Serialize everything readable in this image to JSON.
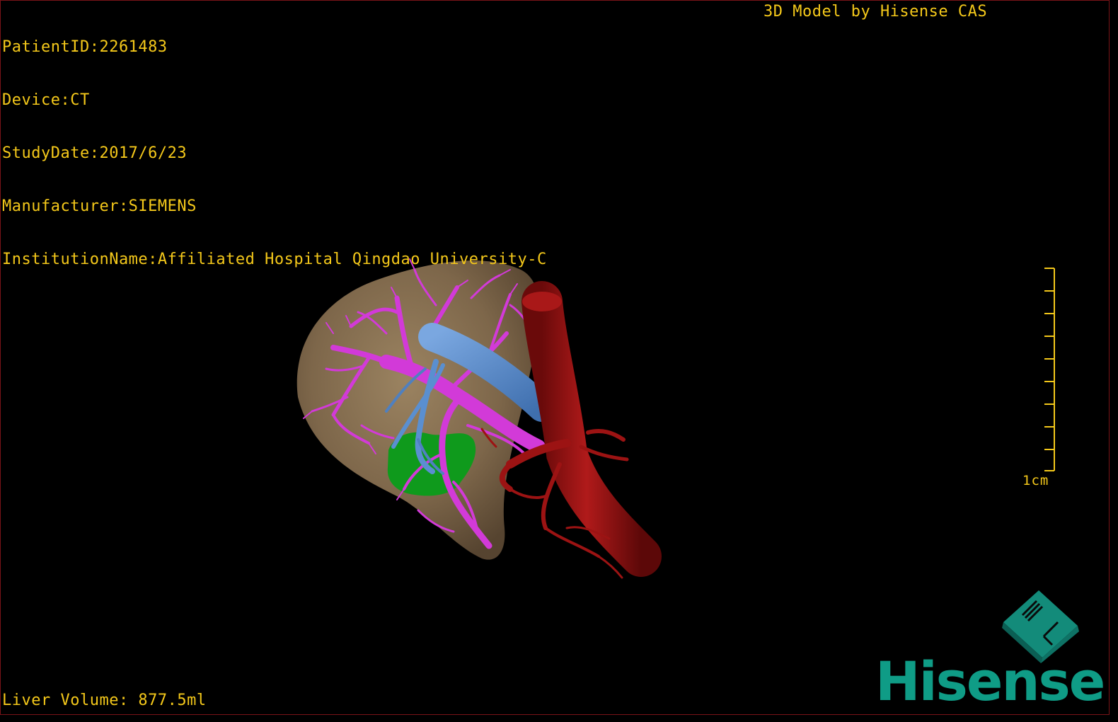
{
  "patient_info": {
    "patient_id": "PatientID:2261483",
    "device": "Device:CT",
    "study_date": "StudyDate:2017/6/23",
    "manufacturer": "Manufacturer:SIEMENS",
    "institution": "InstitutionName:Affiliated Hospital Qingdao University-C"
  },
  "header_right": "3D Model by Hisense CAS",
  "scale_bar": {
    "label": "1cm",
    "color": "#f4c81a"
  },
  "liver_volume": "Liver Volume: 877.5ml",
  "logo": {
    "brand": "Hisense",
    "cube_letters": "H L",
    "color": "#0f9c86"
  },
  "model_colors": {
    "liver": "#8d7656",
    "portal_vein": "#d23ad8",
    "hepatic_vein": "#5a8fd0",
    "aorta": "#9c1313",
    "lesion": "#0f9a1c"
  }
}
